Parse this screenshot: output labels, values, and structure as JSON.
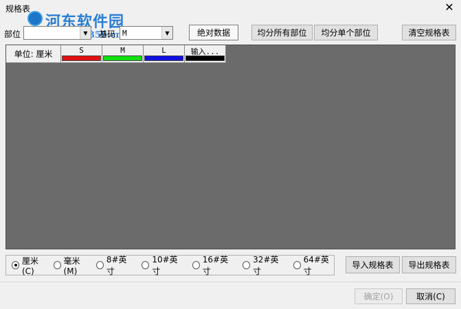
{
  "window": {
    "title": "规格表",
    "close_glyph": "✕"
  },
  "watermark": {
    "title": "河东软件园",
    "url": "www.pc0359.cn"
  },
  "toolbar": {
    "part_label": "部位",
    "part_value": "",
    "base_label": "基码",
    "base_value": "M",
    "absolute_button": "绝对数据",
    "even_all_button": "均分所有部位",
    "even_single_button": "均分单个部位",
    "clear_button": "清空规格表"
  },
  "grid": {
    "unit_header": "单位: 厘米",
    "sizes": [
      {
        "label": "S",
        "color": "#e01010"
      },
      {
        "label": "M",
        "color": "#10e010"
      },
      {
        "label": "L",
        "color": "#1010e0"
      },
      {
        "label": "输入...",
        "color": "#000000"
      }
    ]
  },
  "units": {
    "options": [
      "厘米(C)",
      "毫米(M)",
      "8#英寸",
      "10#英寸",
      "16#英寸",
      "32#英寸",
      "64#英寸"
    ],
    "selected": "厘米(C)"
  },
  "bottom": {
    "import_button": "导入规格表",
    "export_button": "导出规格表",
    "ok_button": "确定(O)",
    "cancel_button": "取消(C)"
  }
}
